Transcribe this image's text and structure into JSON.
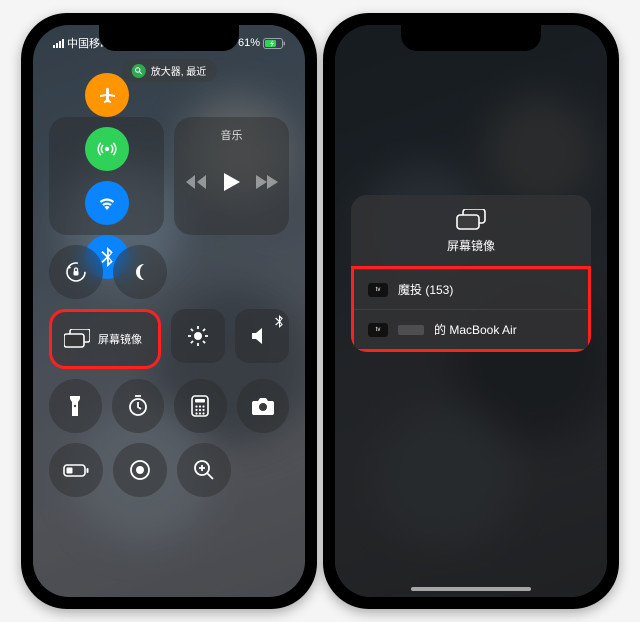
{
  "status": {
    "carrier": "中国移动",
    "battery_pct": "61%"
  },
  "pill": {
    "text": "放大器, 最近"
  },
  "music": {
    "title": "音乐"
  },
  "screen_mirror": {
    "label": "屏幕镜像"
  },
  "sheet": {
    "title": "屏幕镜像",
    "devices": [
      {
        "name": "魔投 (153)"
      },
      {
        "name": "的 MacBook Air"
      }
    ]
  }
}
